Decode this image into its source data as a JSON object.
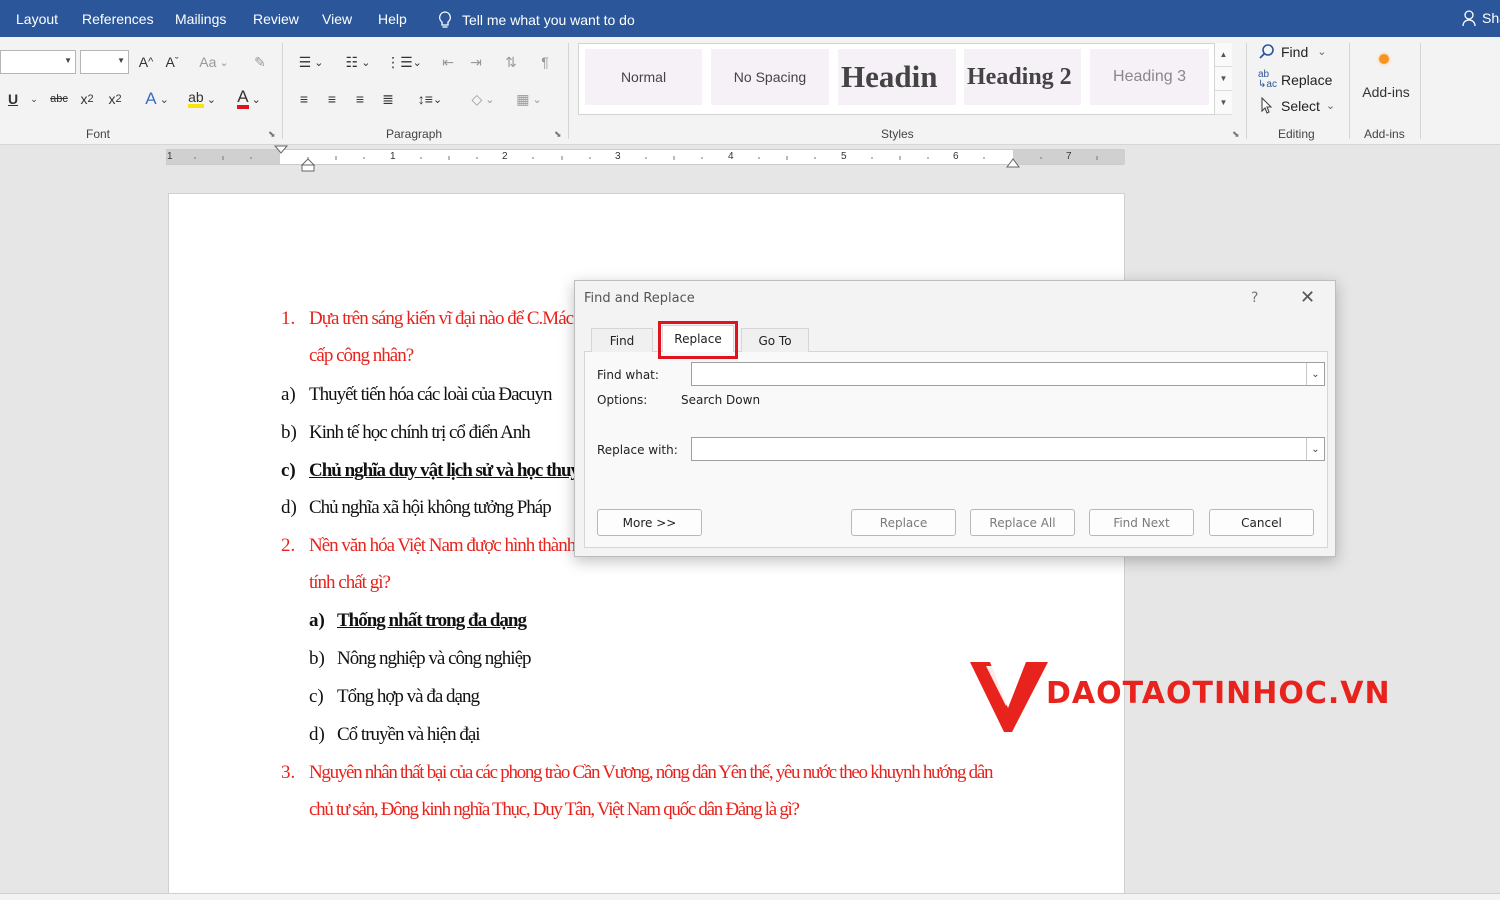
{
  "menubar": {
    "items": [
      "Layout",
      "References",
      "Mailings",
      "Review",
      "View",
      "Help"
    ],
    "tell_me": "Tell me what you want to do",
    "share": "Sha"
  },
  "ribbon": {
    "font_group_label": "Font",
    "paragraph_group_label": "Paragraph",
    "styles_group_label": "Styles",
    "editing_group_label": "Editing",
    "addins_group_label": "Add-ins",
    "change_case": "Aa",
    "styles": [
      "Normal",
      "No Spacing",
      "Headin",
      "Heading 2",
      "Heading 3"
    ],
    "editing": {
      "find": "Find",
      "replace": "Replace",
      "select": "Select"
    },
    "addins_button": "Add-ins"
  },
  "ruler": {
    "numbers": [
      "1",
      "1",
      "2",
      "3",
      "4",
      "5",
      "6",
      "7"
    ]
  },
  "document": {
    "q1": {
      "number": "1.",
      "line1": "Dựa trên sáng kiến vĩ đại nào để C.Mác v",
      "line2": "cấp công nhân?"
    },
    "q1_options": [
      {
        "label": "a)",
        "text": "Thuyết tiến hóa các loài của Đacuyn"
      },
      {
        "label": "b)",
        "text": "Kinh tế học chính trị cổ điển Anh"
      },
      {
        "label": "c)",
        "text": "Chủ nghĩa duy vật lịch sử và học thuy"
      },
      {
        "label": "d)",
        "text": "Chủ nghĩa xã hội không tưởng Pháp"
      }
    ],
    "q2": {
      "number": "2.",
      "line1": "Nền văn hóa Việt Nam được hình thành",
      "line2": "tính chất gì?"
    },
    "q2_options": [
      {
        "label": "a)",
        "text": "Thống nhất trong đa dạng"
      },
      {
        "label": "b)",
        "text": "Nông nghiệp và công nghiệp"
      },
      {
        "label": "c)",
        "text": "Tổng hợp và đa dạng"
      },
      {
        "label": "d)",
        "text": "Cổ truyền và hiện đại"
      }
    ],
    "q3": {
      "number": "3.",
      "line1": "Nguyên nhân thất bại của các phong trào Cần Vương, nông dân Yên thế, yêu nước theo khuynh hướng dân",
      "line2": "chủ tư sản, Đông kinh nghĩa Thục, Duy Tân, Việt Nam quốc dân Đảng là gì?"
    }
  },
  "watermark": {
    "text": "DAOTAOTINHOC.VN"
  },
  "dialog": {
    "title": "Find and Replace",
    "help": "?",
    "tabs": {
      "find": "Find",
      "replace": "Replace",
      "goto": "Go To"
    },
    "find_what_label": "Find what:",
    "find_what_value": "",
    "options_label": "Options:",
    "options_value": "Search Down",
    "replace_with_label": "Replace with:",
    "replace_with_value": "",
    "buttons": {
      "more": "More >>",
      "replace": "Replace",
      "replace_all": "Replace All",
      "find_next": "Find Next",
      "cancel": "Cancel"
    }
  },
  "colors": {
    "title_bar": "#2b579a",
    "red_text": "#e8231d",
    "highlight": "#e0141e"
  }
}
